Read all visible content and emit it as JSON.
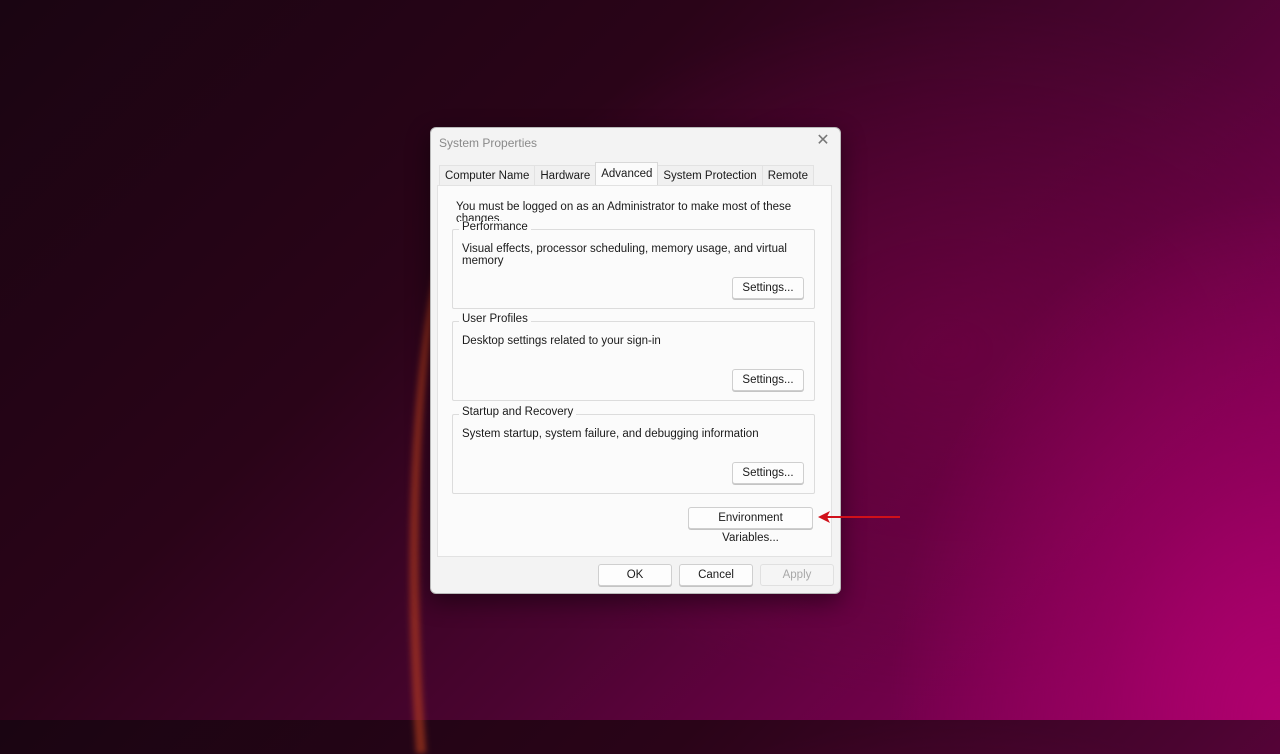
{
  "window": {
    "title": "System Properties",
    "close_icon": "close-icon"
  },
  "tabs": [
    {
      "label": "Computer Name",
      "active": false
    },
    {
      "label": "Hardware",
      "active": false
    },
    {
      "label": "Advanced",
      "active": true
    },
    {
      "label": "System Protection",
      "active": false
    },
    {
      "label": "Remote",
      "active": false
    }
  ],
  "advanced": {
    "admin_note": "You must be logged on as an Administrator to make most of these changes.",
    "groups": [
      {
        "title": "Performance",
        "description": "Visual effects, processor scheduling, memory usage, and virtual memory",
        "button": "Settings..."
      },
      {
        "title": "User Profiles",
        "description": "Desktop settings related to your sign-in",
        "button": "Settings..."
      },
      {
        "title": "Startup and Recovery",
        "description": "System startup, system failure, and debugging information",
        "button": "Settings..."
      }
    ],
    "env_button": "Environment Variables..."
  },
  "footer": {
    "ok": "OK",
    "cancel": "Cancel",
    "apply": "Apply",
    "apply_enabled": false
  },
  "annotation": {
    "arrow_icon": "red-arrow-left-icon",
    "color": "#d0101a"
  }
}
